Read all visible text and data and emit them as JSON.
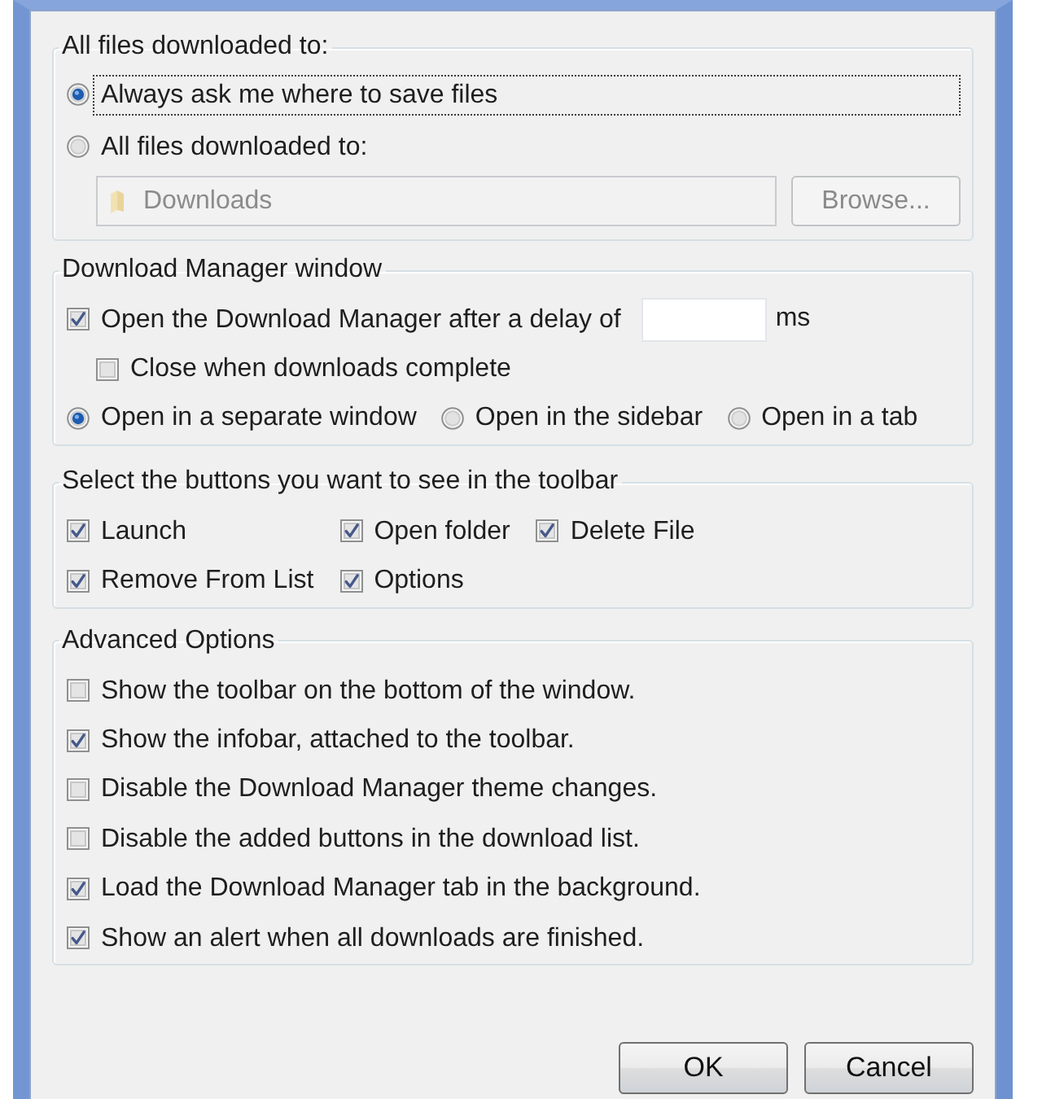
{
  "download_location": {
    "legend": "All files downloaded to:",
    "options": [
      {
        "label": "Always ask me where to save files",
        "selected": true,
        "focused": true
      },
      {
        "label": "All files downloaded to:",
        "selected": false,
        "focused": false
      }
    ],
    "folder_field": {
      "value": "Downloads",
      "disabled": true
    },
    "browse_button": {
      "label": "Browse...",
      "disabled": true
    }
  },
  "manager_window": {
    "legend": "Download Manager window",
    "open_after_delay": {
      "label": "Open the Download Manager after a delay of",
      "checked": true,
      "unit": "ms"
    },
    "close_when_complete": {
      "label": "Close when downloads complete",
      "checked": false
    },
    "open_in": [
      {
        "label": "Open in a separate window",
        "selected": true
      },
      {
        "label": "Open in the sidebar",
        "selected": false
      },
      {
        "label": "Open in a tab",
        "selected": false
      }
    ]
  },
  "toolbar_buttons": {
    "legend": "Select the buttons you want to see in the toolbar",
    "items": [
      {
        "label": "Launch",
        "checked": true
      },
      {
        "label": "Open folder",
        "checked": true
      },
      {
        "label": "Delete File",
        "checked": true
      },
      {
        "label": "Remove From List",
        "checked": true
      },
      {
        "label": "Options",
        "checked": true
      }
    ]
  },
  "advanced_options": {
    "legend": "Advanced Options",
    "items": [
      {
        "label": "Show the toolbar on the bottom of the window.",
        "checked": false
      },
      {
        "label": "Show the infobar, attached to the toolbar.",
        "checked": true
      },
      {
        "label": "Disable the Download Manager theme changes.",
        "checked": false
      },
      {
        "label": "Disable the added buttons in the download list.",
        "checked": false
      },
      {
        "label": "Load the Download Manager tab in the background.",
        "checked": true
      },
      {
        "label": "Show an alert when all downloads are finished.",
        "checked": true
      }
    ]
  },
  "buttons": [
    {
      "label": "OK"
    },
    {
      "label": "Cancel"
    }
  ]
}
